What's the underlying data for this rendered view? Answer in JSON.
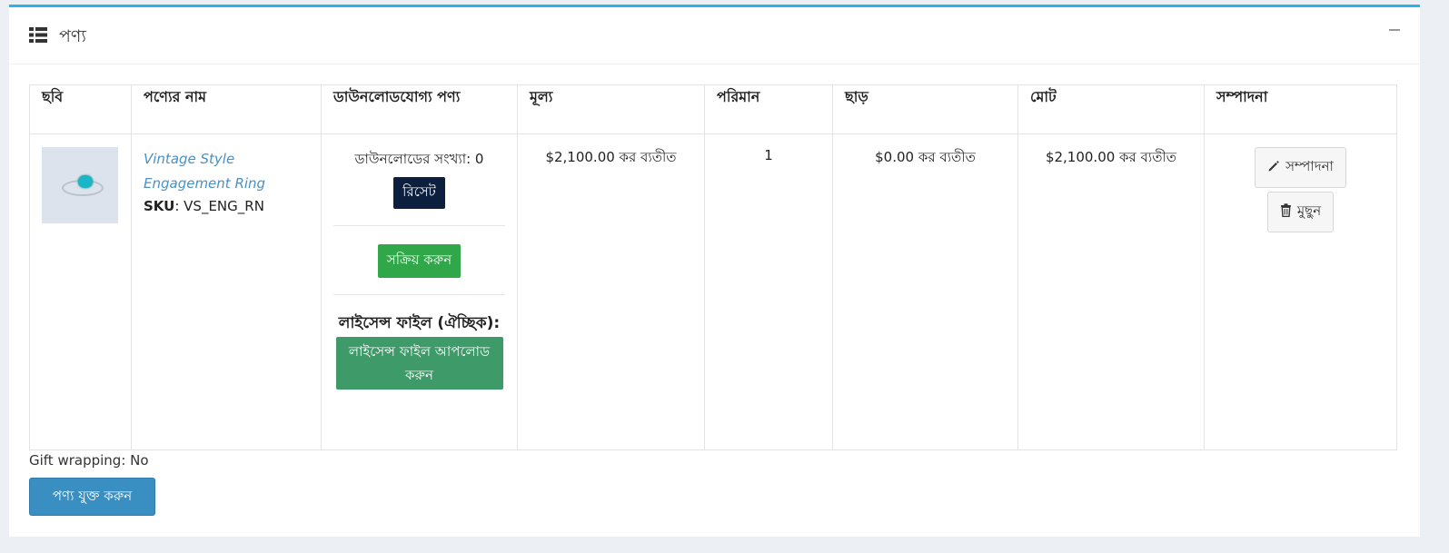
{
  "panel": {
    "title": "পণ্য",
    "list_icon": "list-icon",
    "collapse_icon": "minus-icon"
  },
  "table": {
    "headers": {
      "image": "ছবি",
      "name": "পণ্যের নাম",
      "downloadable": "ডাউনলোডযোগ্য পণ্য",
      "price": "মূল্য",
      "quantity": "পরিমান",
      "discount": "ছাড়",
      "total": "মোট",
      "edit": "সম্পাদনা"
    },
    "row": {
      "image_icon": "ring-image",
      "product_name": "Vintage Style Engagement Ring",
      "sku_label": "SKU",
      "sku_value": ": VS_ENG_RN",
      "download_count": "ডাউনলোডের সংখ্যা: 0",
      "reset_label": "রিসেট",
      "activate_label": "সক্রিয় করুন",
      "license_title": "লাইসেন্স ফাইল (ঐচ্ছিক):",
      "upload_license_label": "লাইসেন্স ফাইল আপলোড করুন",
      "price": "$2,100.00 কর ব্যতীত",
      "quantity": "1",
      "discount": "$0.00 কর ব্যতীত",
      "total": "$2,100.00 কর ব্যতীত",
      "edit_label": "সম্পাদনা",
      "delete_label": "মুছুন"
    }
  },
  "gift_wrapping": "Gift wrapping: No",
  "add_product_label": "পণ্য যুক্ত করুন",
  "colors": {
    "accent_top": "#25b6e6",
    "reset_button": "#0c1f3e",
    "activate_button": "#30a84a",
    "upload_button": "#3e9a69",
    "add_button": "#3a8fc2",
    "link": "#4a90c2"
  }
}
